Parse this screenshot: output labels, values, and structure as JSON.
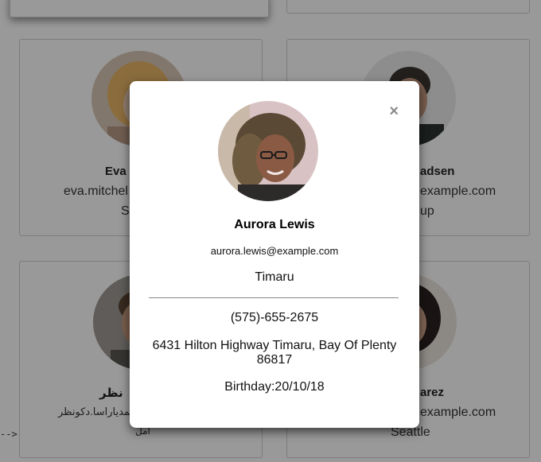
{
  "modal": {
    "close_icon": "close-icon",
    "close_glyph": "×",
    "name": "Aurora Lewis",
    "email": "aurora.lewis@example.com",
    "city": "Timaru",
    "phone": "(575)-655-2675",
    "address": "6431 Hilton Highway Timaru, Bay Of Plenty 86817",
    "birthday": "Birthday:20/10/18"
  },
  "background_cards": [
    {
      "name": "Eva",
      "email": "eva.mitchel",
      "city": "S"
    },
    {
      "name": "adsen",
      "email": "example.com",
      "city": "up"
    },
    {
      "name": "نظر",
      "email": "سمدیاراسا.دکونظر",
      "city": "امل"
    },
    {
      "name": "arez",
      "email": "example.com",
      "city": "Seattle"
    }
  ],
  "stray_text": "-->",
  "colors": {
    "overlay": "rgba(0,0,0,0.4)",
    "modal_bg": "#ffffff",
    "close": "#8a8a8a",
    "divider": "#888888"
  }
}
